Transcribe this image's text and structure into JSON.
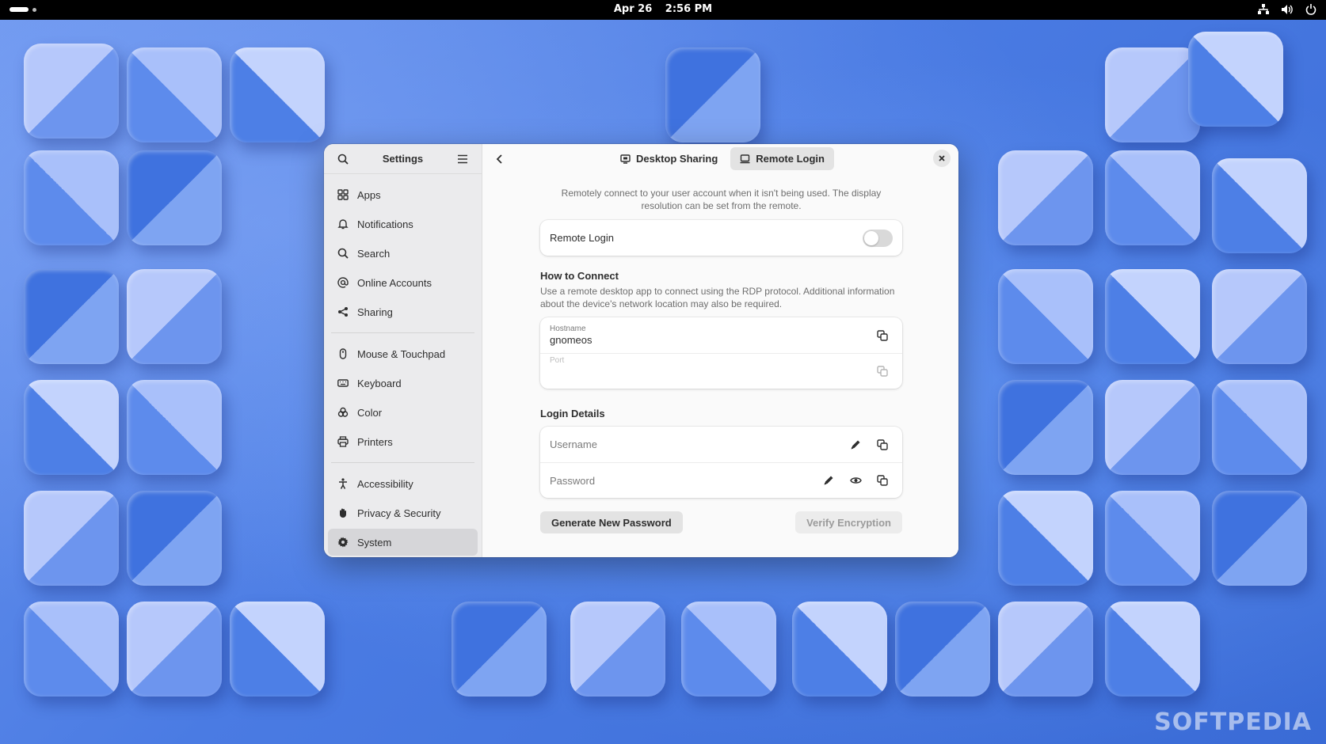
{
  "topbar": {
    "date": "Apr 26",
    "time": "2:56 PM",
    "tray_icons": [
      "network-icon",
      "volume-icon",
      "power-icon"
    ]
  },
  "sidebar": {
    "title": "Settings",
    "items": [
      {
        "label": "Apps",
        "icon": "apps-icon"
      },
      {
        "label": "Notifications",
        "icon": "bell-icon"
      },
      {
        "label": "Search",
        "icon": "search-icon"
      },
      {
        "label": "Online Accounts",
        "icon": "at-icon"
      },
      {
        "label": "Sharing",
        "icon": "share-icon"
      },
      {
        "label": "Mouse & Touchpad",
        "icon": "mouse-icon"
      },
      {
        "label": "Keyboard",
        "icon": "keyboard-icon"
      },
      {
        "label": "Color",
        "icon": "color-icon"
      },
      {
        "label": "Printers",
        "icon": "printer-icon"
      },
      {
        "label": "Accessibility",
        "icon": "accessibility-icon"
      },
      {
        "label": "Privacy & Security",
        "icon": "hand-icon"
      },
      {
        "label": "System",
        "icon": "gear-icon",
        "active": true
      }
    ]
  },
  "tabs": [
    {
      "label": "Desktop Sharing",
      "icon": "monitor-icon",
      "active": false
    },
    {
      "label": "Remote Login",
      "icon": "laptop-icon",
      "active": true
    }
  ],
  "remote_login": {
    "description": "Remotely connect to your user account when it isn't being used. The display resolution can be set from the remote.",
    "toggle_label": "Remote Login",
    "toggle_on": false
  },
  "how_to_connect": {
    "title": "How to Connect",
    "description": "Use a remote desktop app to connect using the RDP protocol. Additional information about the device's network location may also be required.",
    "hostname_label": "Hostname",
    "hostname_value": "gnomeos",
    "port_label": "Port",
    "port_value": ""
  },
  "login_details": {
    "title": "Login Details",
    "username_label": "Username",
    "password_label": "Password"
  },
  "buttons": {
    "generate": "Generate New Password",
    "verify": "Verify Encryption"
  },
  "watermark": "SOFTPEDIA",
  "colors": {
    "wallpaper": "#4f82e6",
    "window_bg": "#fafafa",
    "sidebar_bg": "#ebebed",
    "toggle_off": "#d9d9d9"
  }
}
